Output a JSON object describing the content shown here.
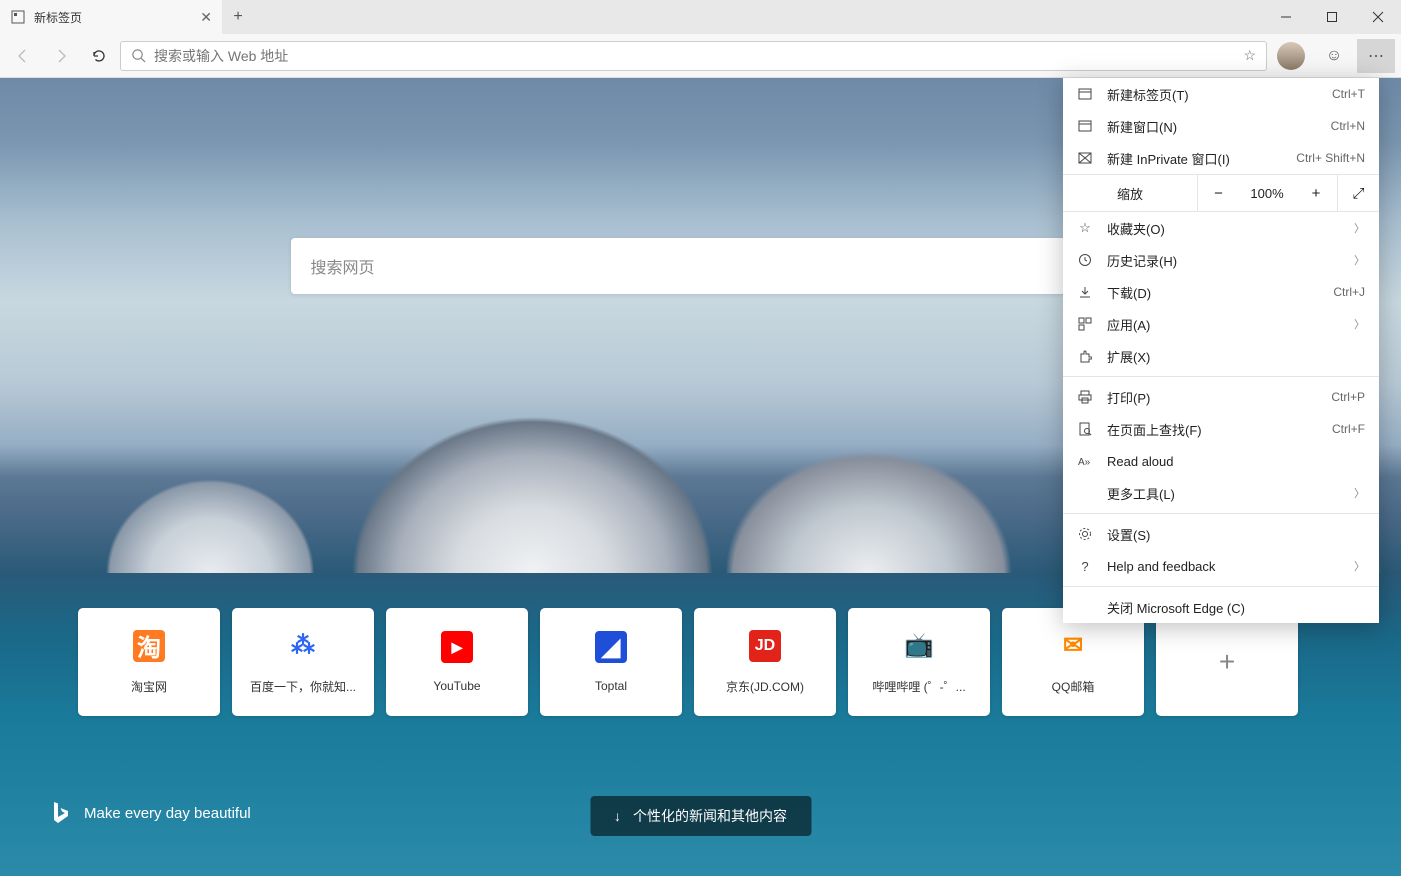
{
  "tab": {
    "title": "新标签页"
  },
  "address": {
    "placeholder": "搜索或输入 Web 地址"
  },
  "search": {
    "placeholder": "搜索网页"
  },
  "tiles": [
    {
      "label": "淘宝网",
      "icon_text": "淘",
      "bg": "#ff7a20",
      "fg": "#fff"
    },
    {
      "label": "百度一下，你就知...",
      "icon_text": "⁂",
      "bg": "#fff",
      "fg": "#2b66f6"
    },
    {
      "label": "YouTube",
      "icon_text": "▶",
      "bg": "#ff0000",
      "fg": "#fff"
    },
    {
      "label": "Toptal",
      "icon_text": "◢",
      "bg": "#1f4fd8",
      "fg": "#fff"
    },
    {
      "label": "京东(JD.COM)",
      "icon_text": "JD",
      "bg": "#e22319",
      "fg": "#fff"
    },
    {
      "label": "哔哩哔哩 (゜-゜...",
      "icon_text": "📺",
      "bg": "#fff",
      "fg": "#00a1d6"
    },
    {
      "label": "QQ邮箱",
      "icon_text": "✉",
      "bg": "#fff",
      "fg": "#ff8a00"
    }
  ],
  "bing": {
    "tagline": "Make every day beautiful"
  },
  "news_button": "个性化的新闻和其他内容",
  "menu": {
    "new_tab": {
      "label": "新建标签页(T)",
      "shortcut": "Ctrl+T"
    },
    "new_window": {
      "label": "新建窗口(N)",
      "shortcut": "Ctrl+N"
    },
    "new_inprivate": {
      "label": "新建 InPrivate 窗口(I)",
      "shortcut": "Ctrl+ Shift+N"
    },
    "zoom": {
      "label": "缩放",
      "value": "100%"
    },
    "favorites": {
      "label": "收藏夹(O)"
    },
    "history": {
      "label": "历史记录(H)"
    },
    "downloads": {
      "label": "下载(D)",
      "shortcut": "Ctrl+J"
    },
    "apps": {
      "label": "应用(A)"
    },
    "extensions": {
      "label": "扩展(X)"
    },
    "print": {
      "label": "打印(P)",
      "shortcut": "Ctrl+P"
    },
    "find": {
      "label": "在页面上查找(F)",
      "shortcut": "Ctrl+F"
    },
    "read_aloud": {
      "label": "Read aloud"
    },
    "more_tools": {
      "label": "更多工具(L)"
    },
    "settings": {
      "label": "设置(S)"
    },
    "help": {
      "label": "Help and feedback"
    },
    "close_edge": {
      "label": "关闭 Microsoft Edge (C)"
    }
  }
}
